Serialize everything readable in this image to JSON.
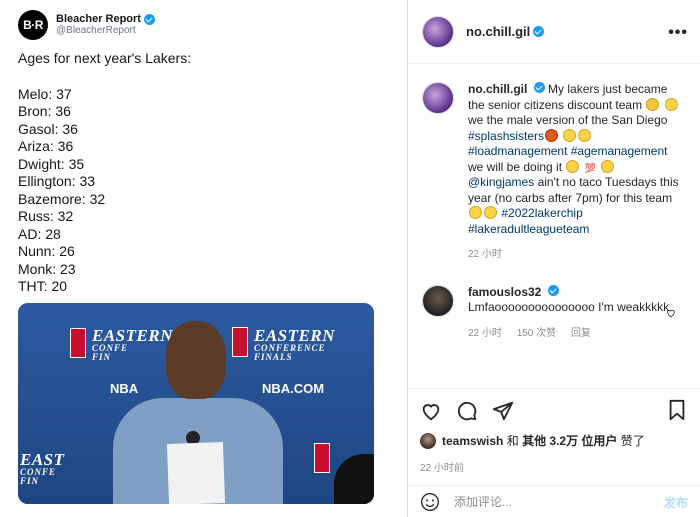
{
  "tweet": {
    "logo_text": "B·R",
    "name": "Bleacher Report",
    "handle": "@BleacherReport",
    "headline": "Ages for next year's Lakers:",
    "lines": [
      "Melo: 37",
      "Bron: 36",
      "Gasol: 36",
      "Ariza: 36",
      "Dwight: 35",
      "Ellington: 33",
      "Bazemore: 32",
      "Russ: 32",
      "AD: 28",
      "Nunn: 26",
      "Monk: 23",
      "THT: 20"
    ],
    "photo": {
      "backdrop_big": "EASTERN",
      "backdrop_mid": "CONFERENCE",
      "backdrop_small": "FINALS",
      "nba_com": "NBA.COM",
      "nba_short": "NBA",
      "east_fragment": "EAST",
      "conf_fragment": "CONFE",
      "fin_fragment": "FIN"
    }
  },
  "post": {
    "username": "no.chill.gil",
    "more_label": "•••",
    "caption": {
      "username": "no.chill.gil",
      "text1": "My lakers just became the senior citizens discount team",
      "text2": "we the male version of the San Diego",
      "tag_splash": "#splashsisters",
      "tag_load": "#loadmanagement",
      "tag_age": "#agemanagement",
      "text3": "we will be doing it",
      "mention": "@kingjames",
      "text4": "ain't no taco Tuesdays this year (no carbs after 7pm) for this team",
      "tag_chip": "#2022lakerchip",
      "tag_league": "#lakeradultleagueteam",
      "time": "22 小时",
      "emoji_100": "💯"
    },
    "reply": {
      "username": "famouslos32",
      "text": "Lmfaooooooooooooooo I'm weakkkkk",
      "time": "22 小时",
      "likes": "150 次赞",
      "reply_label": "回复"
    },
    "likes": {
      "user": "teamswish",
      "connector": "和",
      "others": "其他 3.2万 位用户",
      "suffix": "赞了"
    },
    "time": "22 小时前",
    "add_comment": {
      "placeholder": "添加评论...",
      "post_label": "发布"
    }
  },
  "colors": {
    "verified": "#1d9bf0",
    "hashtag": "#00376b",
    "secondary_text": "#8e8e8e",
    "post_disabled": "#b2dffc"
  }
}
